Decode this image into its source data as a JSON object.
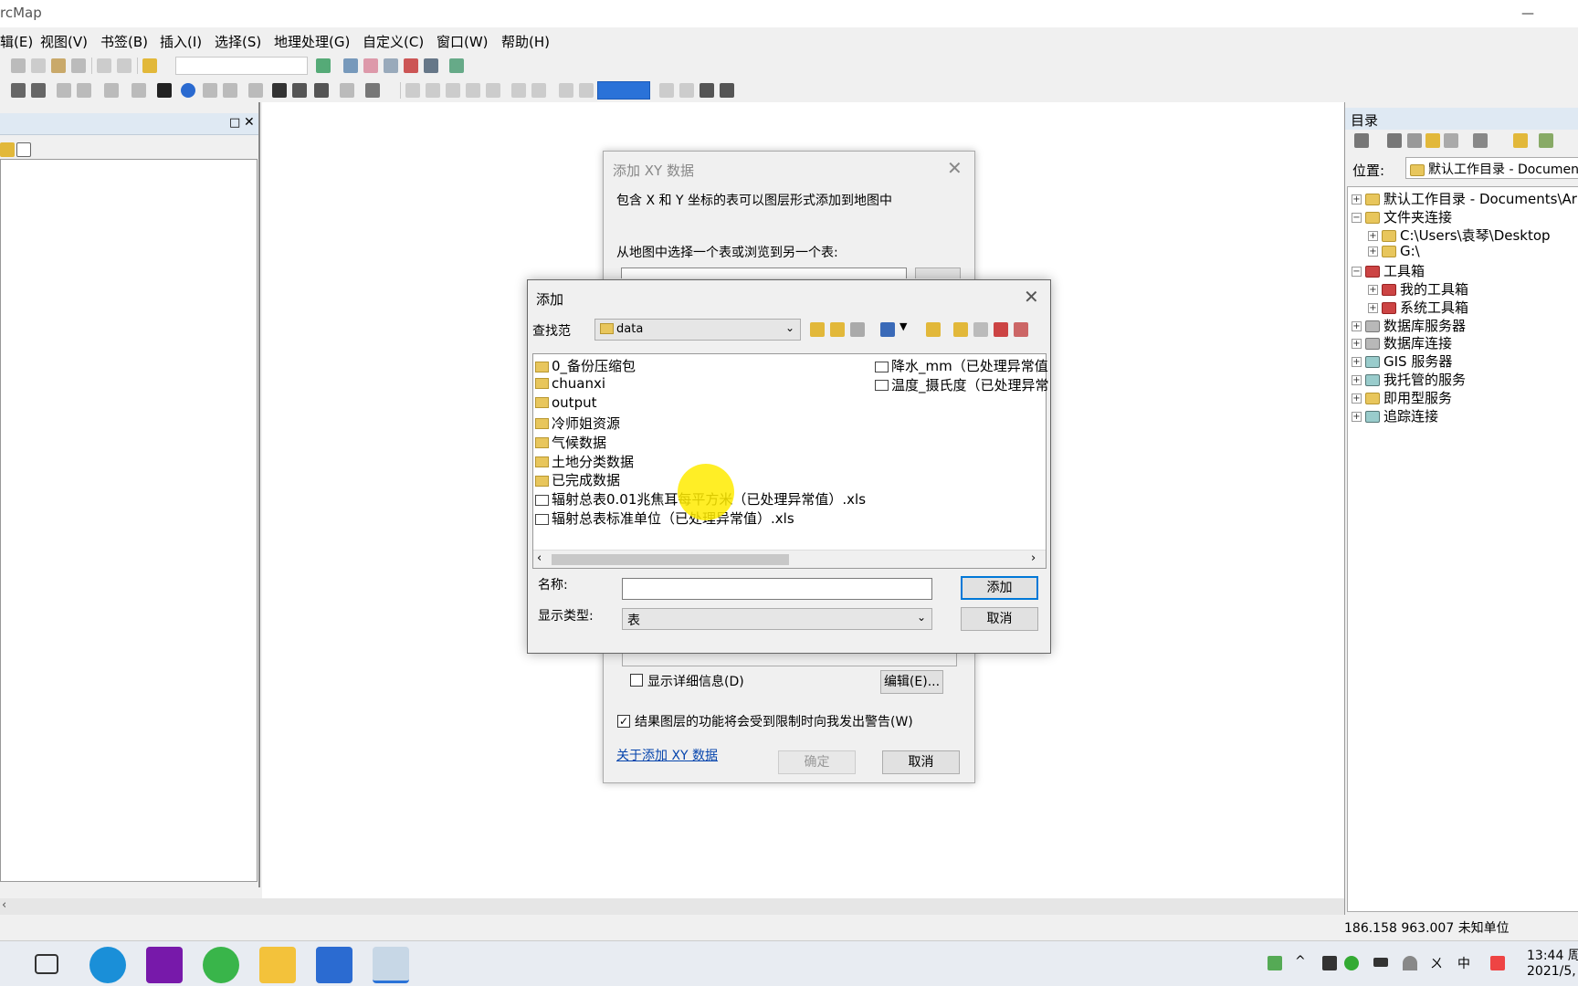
{
  "window": {
    "title": "rcMap",
    "minimize": "—",
    "maximize": "☐"
  },
  "menu": [
    "辑(E)",
    "视图(V)",
    "书签(B)",
    "插入(I)",
    "选择(S)",
    "地理处理(G)",
    "自定义(C)",
    "窗口(W)",
    "帮助(H)"
  ],
  "toolbar": {
    "scale_value": "",
    "layer_combo": ""
  },
  "catalog": {
    "title": "目录",
    "location_label": "位置:",
    "location_value": "默认工作目录 - Documents",
    "tree": [
      {
        "label": "默认工作目录 - Documents\\Ar",
        "level": 0,
        "expander": "+",
        "icon": "folder-icon"
      },
      {
        "label": "文件夹连接",
        "level": 0,
        "expander": "−",
        "icon": "folder-icon"
      },
      {
        "label": "C:\\Users\\袁琴\\Desktop",
        "level": 1,
        "expander": "+",
        "icon": "folder-icon"
      },
      {
        "label": "G:\\",
        "level": 1,
        "expander": "+",
        "icon": "folder-icon"
      },
      {
        "label": "工具箱",
        "level": 0,
        "expander": "−",
        "icon": "toolbox-icon"
      },
      {
        "label": "我的工具箱",
        "level": 1,
        "expander": "+",
        "icon": "toolbox-icon"
      },
      {
        "label": "系统工具箱",
        "level": 1,
        "expander": "+",
        "icon": "toolbox-icon"
      },
      {
        "label": "数据库服务器",
        "level": 0,
        "expander": "+",
        "icon": "database-server-icon"
      },
      {
        "label": "数据库连接",
        "level": 0,
        "expander": "+",
        "icon": "database-connection-icon"
      },
      {
        "label": "GIS 服务器",
        "level": 0,
        "expander": "+",
        "icon": "gis-server-icon"
      },
      {
        "label": "我托管的服务",
        "level": 0,
        "expander": "+",
        "icon": "hosted-service-icon"
      },
      {
        "label": "即用型服务",
        "level": 0,
        "expander": "+",
        "icon": "ready-service-icon"
      },
      {
        "label": "追踪连接",
        "level": 0,
        "expander": "+",
        "icon": "tracking-icon"
      }
    ]
  },
  "status": {
    "coords": "186.158  963.007 未知单位"
  },
  "xy_dialog": {
    "title": "添加 XY 数据",
    "description": "包含 X 和 Y 坐标的表可以图层形式添加到地图中",
    "choose_label": "从地图中选择一个表或浏览到另一个表:",
    "show_details_label": "显示详细信息(D)",
    "edit_button": "编辑(E)...",
    "warn_label": "结果图层的功能将会受到限制时向我发出警告(W)",
    "warn_checked": "✓",
    "about_link": "关于添加 XY 数据",
    "ok_button": "确定",
    "cancel_button": "取消",
    "close": "✕"
  },
  "add_dialog": {
    "title": "添加",
    "close": "✕",
    "look_in_label": "查找范",
    "look_in_value": "data",
    "files_left": [
      {
        "name": "0_备份压缩包",
        "type": "folder"
      },
      {
        "name": "chuanxi",
        "type": "folder"
      },
      {
        "name": "output",
        "type": "folder"
      },
      {
        "name": "冷师姐资源",
        "type": "folder"
      },
      {
        "name": "气候数据",
        "type": "folder"
      },
      {
        "name": "土地分类数据",
        "type": "folder"
      },
      {
        "name": "已完成数据",
        "type": "folder"
      },
      {
        "name": "辐射总表0.01兆焦耳每平方米（已处理异常值）.xls",
        "type": "table"
      },
      {
        "name": "辐射总表标准单位（已处理异常值）.xls",
        "type": "table"
      }
    ],
    "files_right": [
      {
        "name": "降水_mm（已处理异常值",
        "type": "table"
      },
      {
        "name": "温度_摄氏度（已处理异常",
        "type": "table"
      }
    ],
    "name_label": "名称:",
    "name_value": "",
    "type_label": "显示类型:",
    "type_value": "表",
    "add_button": "添加",
    "cancel_button": "取消"
  },
  "taskbar": {
    "clock_time": "13:44 周",
    "clock_date": "2021/5,",
    "ime": "中",
    "volume": "ㄨ"
  },
  "colors": {
    "accent": "#0078d7",
    "panel_header": "#dfe9f3",
    "highlight": "#ffeb00"
  }
}
